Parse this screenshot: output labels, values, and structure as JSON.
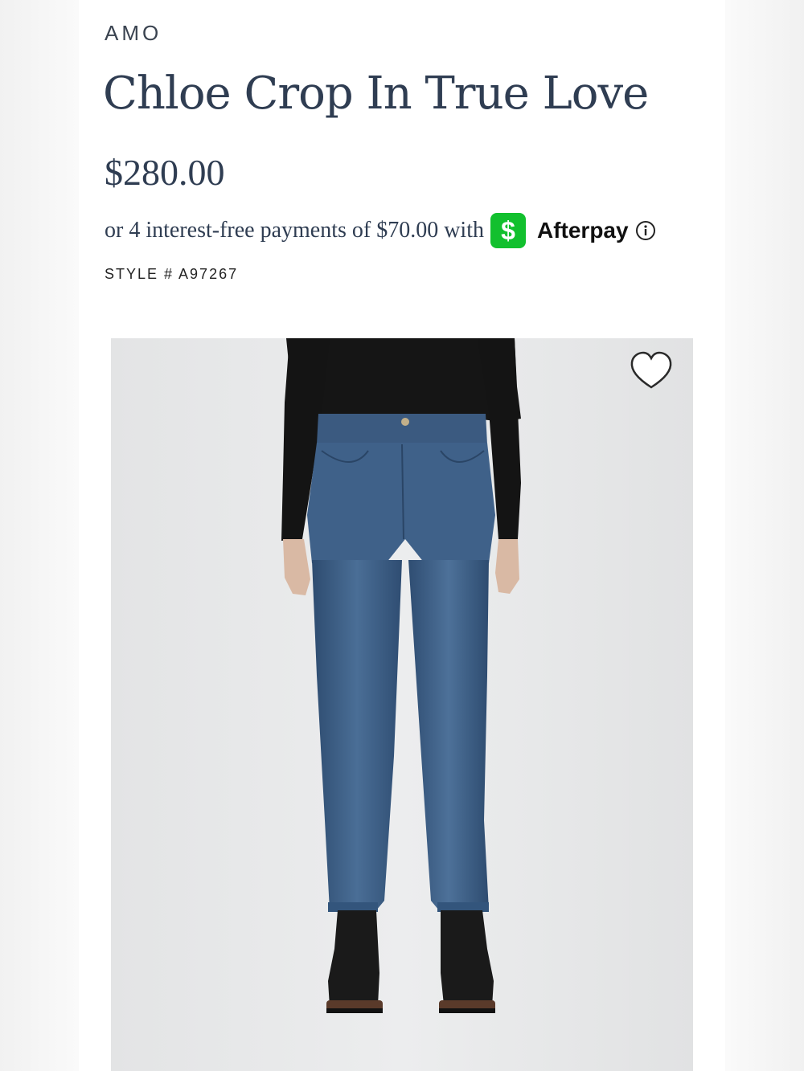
{
  "product": {
    "brand": "AMO",
    "title": "Chloe Crop In True Love",
    "price": "$280.00",
    "installments_text": "or 4 interest-free payments of $70.00 with",
    "payment_badge_symbol": "$",
    "payment_provider": "Afterpay",
    "style_number": "STYLE # A97267"
  },
  "icons": {
    "payment_badge": "cash-app-icon",
    "info": "info-circle-icon",
    "wishlist": "heart-outline-icon"
  },
  "colors": {
    "text_primary": "#2f3d52",
    "payment_badge": "#12c02e",
    "photo_background": "#e7e8e9",
    "denim": "#3d5f86"
  }
}
